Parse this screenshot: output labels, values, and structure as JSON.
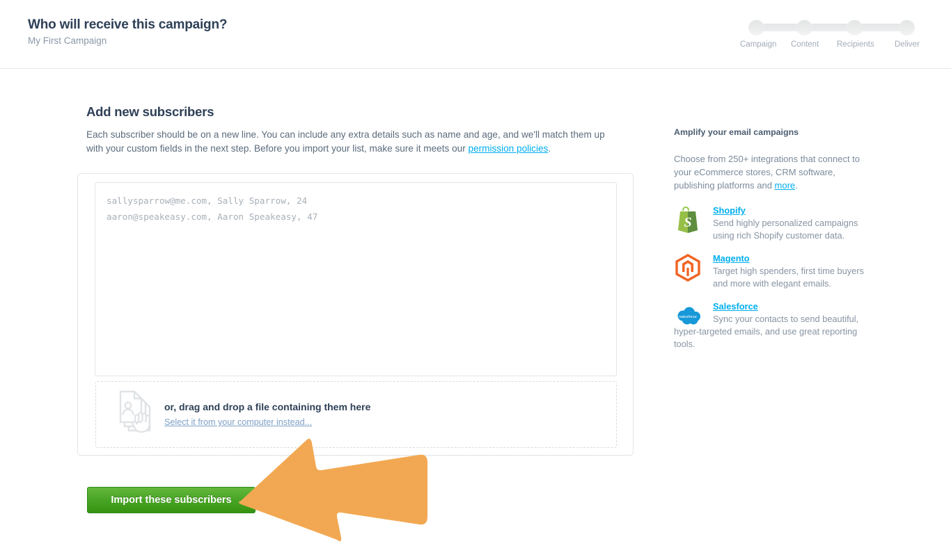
{
  "header": {
    "title": "Who will receive this campaign?",
    "subtitle": "My First Campaign"
  },
  "stepper": {
    "steps": [
      {
        "label": "Campaign"
      },
      {
        "label": "Content"
      },
      {
        "label": "Recipients"
      },
      {
        "label": "Deliver"
      }
    ]
  },
  "main": {
    "heading": "Add new subscribers",
    "description_part1": "Each subscriber should be on a new line. You can include any extra details such as name and age, and we'll match them up with your custom fields in the next step. Before you import your list, make sure it meets our ",
    "description_link": "permission policies",
    "description_part2": "."
  },
  "import": {
    "textarea_placeholder": "sallysparrow@me.com, Sally Sparrow, 24\naaron@speakeasy.com, Aaron Speakeasy, 47",
    "textarea_value": "",
    "dropzone_icon": "document-contact-drag-icon",
    "dropzone_title": "or, drag and drop a file containing them here",
    "dropzone_link": "Select it from your computer instead...",
    "submit_label": "Import these subscribers",
    "submit_color": "#4aa527"
  },
  "annotation": {
    "arrow_icon": "left-pointing-arrow-annotation",
    "arrow_color": "#F2A852"
  },
  "sidebar": {
    "title": "Amplify your email campaigns",
    "intro_part1": "Choose from 250+ integrations that connect to your eCommerce stores, CRM software, publishing platforms and ",
    "intro_link": "more",
    "intro_part2": ".",
    "integrations": [
      {
        "icon": "shopify-bag-icon",
        "name": "Shopify",
        "description": "Send highly personalized campaigns using rich Shopify customer data."
      },
      {
        "icon": "magento-hexagon-icon",
        "name": "Magento",
        "description": "Target high spenders, first time buyers and more with elegant emails."
      },
      {
        "icon": "salesforce-cloud-icon",
        "name": "Salesforce",
        "description": "Sync your contacts to send beautiful, hyper-targeted emails, and use great reporting tools."
      }
    ]
  },
  "colors": {
    "link_cyan": "#00aeef",
    "heading": "#2e4057",
    "body_text": "#7b8b9c",
    "accent_green": "#4aa527",
    "accent_orange": "#F2A852"
  }
}
